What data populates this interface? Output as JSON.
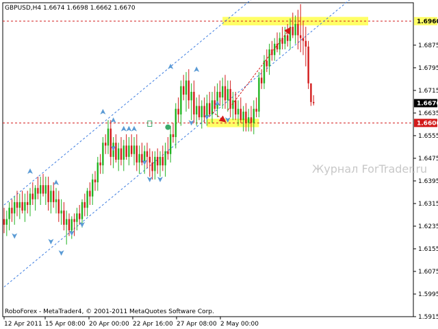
{
  "chart_header": "GBPUSD,H4  1.6674 1.6698 1.6662 1.6670",
  "footer_text": "RoboForex - MetaTrader4, © 2001-2011 MetaQuotes Software Corp.",
  "watermark": "Журнал ForTrader.ru",
  "colors": {
    "bull": "#21b321",
    "bear": "#d21a1a",
    "channel": "#3a7be0",
    "level": "#d21a1a",
    "highlight": "#ffff66",
    "fractal": "#5b9bd5"
  },
  "chart_data": {
    "type": "candlestick",
    "symbol": "GBPUSD",
    "timeframe": "H4",
    "ylim": [
      1.5915,
      1.7025
    ],
    "yticks": [
      "1.6875",
      "1.6795",
      "1.6715",
      "1.6635",
      "1.6555",
      "1.6475",
      "1.6395",
      "1.6315",
      "1.6235",
      "1.6155",
      "1.6075",
      "1.5995",
      "1.5915"
    ],
    "xticks": [
      "12 Apr 2011",
      "15 Apr 08:00",
      "20 Apr 00:00",
      "22 Apr 16:00",
      "27 Apr 08:00",
      "2 May 00:00"
    ],
    "price_labels": {
      "level_high": "1.6960",
      "current": "1.6670",
      "level_low": "1.6600"
    },
    "levels": [
      1.696,
      1.66
    ],
    "current_price": 1.667,
    "ohlc": {
      "open": [
        1.626,
        1.624,
        1.626,
        1.63,
        1.628,
        1.632,
        1.63,
        1.632,
        1.629,
        1.632,
        1.631,
        1.635,
        1.633,
        1.637,
        1.635,
        1.638,
        1.635,
        1.638,
        1.632,
        1.636,
        1.632,
        1.633,
        1.628,
        1.629,
        1.624,
        1.626,
        1.622,
        1.626,
        1.625,
        1.628,
        1.626,
        1.632,
        1.63,
        1.636,
        1.634,
        1.64,
        1.639,
        1.646,
        1.645,
        1.653,
        1.652,
        1.658,
        1.648,
        1.653,
        1.647,
        1.651,
        1.647,
        1.652,
        1.648,
        1.652,
        1.649,
        1.652,
        1.646,
        1.649,
        1.646,
        1.65,
        1.648,
        1.646,
        1.643,
        1.648,
        1.645,
        1.648,
        1.645,
        1.65,
        1.649,
        1.656,
        1.655,
        1.665,
        1.663,
        1.673,
        1.67,
        1.675,
        1.668,
        1.671,
        1.663,
        1.666,
        1.662,
        1.666,
        1.662,
        1.667,
        1.663,
        1.668,
        1.665,
        1.671,
        1.669,
        1.673,
        1.668,
        1.672,
        1.665,
        1.668,
        1.663,
        1.665,
        1.661,
        1.664,
        1.66,
        1.662,
        1.66,
        1.665,
        1.664,
        1.676,
        1.674,
        1.682,
        1.68,
        1.686,
        1.684,
        1.688,
        1.686,
        1.69,
        1.688,
        1.691,
        1.689,
        1.694,
        1.691,
        1.695,
        1.691,
        1.69,
        1.689,
        1.687,
        1.674,
        1.6674
      ],
      "high": [
        1.63,
        1.629,
        1.632,
        1.633,
        1.634,
        1.636,
        1.635,
        1.636,
        1.635,
        1.636,
        1.637,
        1.639,
        1.638,
        1.641,
        1.641,
        1.642,
        1.641,
        1.641,
        1.638,
        1.639,
        1.637,
        1.636,
        1.633,
        1.632,
        1.629,
        1.628,
        1.627,
        1.628,
        1.63,
        1.631,
        1.633,
        1.635,
        1.637,
        1.639,
        1.642,
        1.643,
        1.648,
        1.649,
        1.655,
        1.656,
        1.661,
        1.661,
        1.655,
        1.656,
        1.653,
        1.655,
        1.654,
        1.656,
        1.655,
        1.656,
        1.655,
        1.656,
        1.652,
        1.653,
        1.652,
        1.653,
        1.651,
        1.65,
        1.65,
        1.651,
        1.65,
        1.652,
        1.653,
        1.655,
        1.659,
        1.66,
        1.667,
        1.669,
        1.675,
        1.677,
        1.678,
        1.679,
        1.674,
        1.675,
        1.669,
        1.67,
        1.668,
        1.669,
        1.67,
        1.671,
        1.671,
        1.673,
        1.674,
        1.675,
        1.676,
        1.677,
        1.675,
        1.675,
        1.671,
        1.671,
        1.668,
        1.669,
        1.666,
        1.667,
        1.665,
        1.666,
        1.668,
        1.669,
        1.678,
        1.679,
        1.684,
        1.686,
        1.688,
        1.689,
        1.69,
        1.692,
        1.692,
        1.694,
        1.694,
        1.695,
        1.697,
        1.699,
        1.698,
        1.7,
        1.702,
        1.696,
        1.694,
        1.689,
        1.6698,
        1.6698
      ],
      "low": [
        1.621,
        1.62,
        1.622,
        1.625,
        1.624,
        1.627,
        1.626,
        1.628,
        1.625,
        1.628,
        1.627,
        1.631,
        1.629,
        1.633,
        1.631,
        1.634,
        1.631,
        1.629,
        1.628,
        1.63,
        1.628,
        1.625,
        1.624,
        1.622,
        1.617,
        1.62,
        1.619,
        1.62,
        1.622,
        1.624,
        1.623,
        1.627,
        1.627,
        1.631,
        1.631,
        1.636,
        1.636,
        1.642,
        1.642,
        1.649,
        1.649,
        1.645,
        1.644,
        1.646,
        1.643,
        1.645,
        1.643,
        1.647,
        1.645,
        1.648,
        1.645,
        1.643,
        1.642,
        1.645,
        1.642,
        1.644,
        1.641,
        1.64,
        1.64,
        1.642,
        1.641,
        1.643,
        1.641,
        1.647,
        1.646,
        1.653,
        1.651,
        1.66,
        1.659,
        1.668,
        1.664,
        1.665,
        1.661,
        1.66,
        1.659,
        1.661,
        1.658,
        1.66,
        1.659,
        1.662,
        1.66,
        1.664,
        1.662,
        1.666,
        1.665,
        1.665,
        1.664,
        1.662,
        1.661,
        1.661,
        1.659,
        1.66,
        1.657,
        1.657,
        1.657,
        1.657,
        1.656,
        1.662,
        1.662,
        1.672,
        1.672,
        1.678,
        1.677,
        1.682,
        1.682,
        1.685,
        1.684,
        1.686,
        1.686,
        1.687,
        1.686,
        1.69,
        1.688,
        1.686,
        1.685,
        1.684,
        1.68,
        1.672,
        1.666,
        1.6662
      ],
      "close": [
        1.624,
        1.626,
        1.63,
        1.628,
        1.632,
        1.63,
        1.632,
        1.629,
        1.632,
        1.631,
        1.635,
        1.633,
        1.637,
        1.635,
        1.638,
        1.635,
        1.638,
        1.632,
        1.636,
        1.632,
        1.633,
        1.628,
        1.629,
        1.624,
        1.626,
        1.622,
        1.626,
        1.625,
        1.628,
        1.626,
        1.632,
        1.63,
        1.636,
        1.634,
        1.64,
        1.639,
        1.646,
        1.645,
        1.653,
        1.652,
        1.658,
        1.648,
        1.653,
        1.647,
        1.651,
        1.647,
        1.652,
        1.648,
        1.652,
        1.649,
        1.652,
        1.646,
        1.649,
        1.646,
        1.65,
        1.648,
        1.646,
        1.643,
        1.648,
        1.645,
        1.648,
        1.645,
        1.65,
        1.649,
        1.656,
        1.655,
        1.665,
        1.663,
        1.673,
        1.67,
        1.675,
        1.668,
        1.671,
        1.663,
        1.666,
        1.662,
        1.666,
        1.662,
        1.667,
        1.663,
        1.668,
        1.665,
        1.671,
        1.669,
        1.673,
        1.668,
        1.672,
        1.665,
        1.668,
        1.663,
        1.665,
        1.661,
        1.664,
        1.66,
        1.662,
        1.66,
        1.665,
        1.664,
        1.676,
        1.674,
        1.682,
        1.68,
        1.686,
        1.684,
        1.688,
        1.686,
        1.69,
        1.688,
        1.691,
        1.689,
        1.694,
        1.691,
        1.695,
        1.691,
        1.69,
        1.689,
        1.687,
        1.674,
        1.6674,
        1.667
      ]
    },
    "channel": {
      "lower": {
        "x": [
          0,
          140
        ],
        "y": [
          1.602,
          1.709
        ]
      },
      "upper": {
        "x": [
          0,
          140
        ],
        "y": [
          1.631,
          1.738
        ]
      }
    },
    "highlight_zones": [
      {
        "x": [
          84,
          140
        ],
        "y": [
          1.6945,
          1.6975
        ]
      },
      {
        "x": [
          78,
          98
        ],
        "y": [
          1.6585,
          1.6615
        ]
      }
    ],
    "forecast_arrows": [
      {
        "from": [
          80,
          1.664
        ],
        "to": [
          85,
          1.6605
        ]
      },
      {
        "from": [
          86,
          1.6645
        ],
        "to": [
          110,
          1.6935
        ]
      }
    ],
    "fractals_up": [
      [
        10,
        1.6425
      ],
      [
        20,
        1.6385
      ],
      [
        38,
        1.6635
      ],
      [
        42,
        1.6605
      ],
      [
        46,
        1.6575
      ],
      [
        48,
        1.6575
      ],
      [
        50,
        1.6575
      ],
      [
        64,
        1.6795
      ],
      [
        74,
        1.6785
      ],
      [
        82,
        1.6665
      ]
    ],
    "fractals_down": [
      [
        4,
        1.6205
      ],
      [
        18,
        1.6185
      ],
      [
        22,
        1.6145
      ],
      [
        26,
        1.6215
      ],
      [
        30,
        1.6245
      ],
      [
        42,
        1.6515
      ],
      [
        54,
        1.6465
      ],
      [
        56,
        1.6405
      ],
      [
        60,
        1.6405
      ],
      [
        78,
        1.6625
      ],
      [
        86,
        1.6615
      ],
      [
        72,
        1.6605
      ]
    ],
    "markers": [
      {
        "type": "circle",
        "x": 63,
        "y": 1.6585
      },
      {
        "type": "pivot",
        "x": 56,
        "y": 1.6595
      }
    ]
  }
}
